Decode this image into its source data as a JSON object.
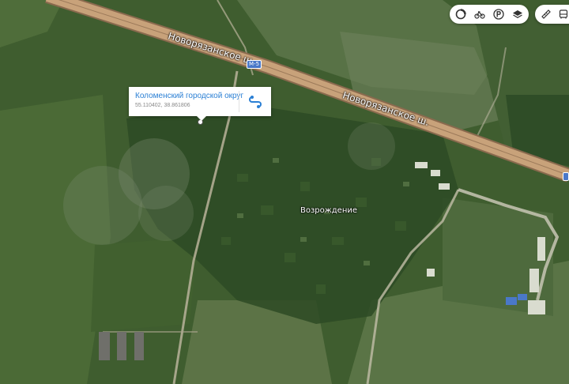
{
  "map": {
    "roads": [
      {
        "name": "Новорязанское ш."
      },
      {
        "name": "Новорязанское ш."
      }
    ],
    "route_shield": "М-5",
    "places": [
      {
        "name": "Возрождение"
      }
    ]
  },
  "popup": {
    "title": "Коломенский городской округ",
    "coordinates": "55.110402, 38.861806"
  },
  "toolbar": {
    "buttons": [
      {
        "icon": "layers-circle-icon"
      },
      {
        "icon": "bicycle-icon"
      },
      {
        "icon": "parking-icon"
      },
      {
        "icon": "map-layers-icon"
      },
      {
        "icon": "ruler-icon"
      },
      {
        "icon": "bus-icon"
      }
    ]
  },
  "colors": {
    "highway": "#c8a27a",
    "link": "#2a7fd4",
    "shield": "#4a78c8"
  }
}
